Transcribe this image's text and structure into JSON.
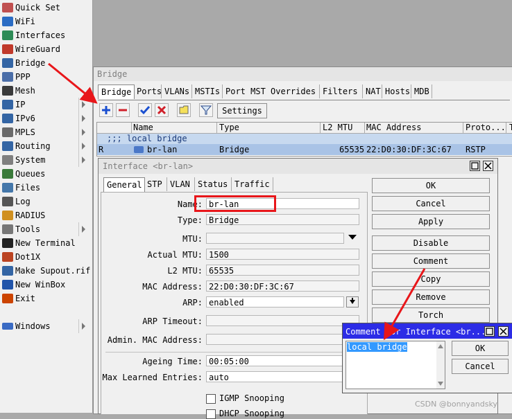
{
  "menu": {
    "items": [
      {
        "label": "Quick Set",
        "icon": "quick-set-icon",
        "arrow": false
      },
      {
        "label": "WiFi",
        "icon": "wifi-icon",
        "arrow": false
      },
      {
        "label": "Interfaces",
        "icon": "interfaces-icon",
        "arrow": false
      },
      {
        "label": "WireGuard",
        "icon": "wireguard-icon",
        "arrow": false
      },
      {
        "label": "Bridge",
        "icon": "bridge-icon",
        "arrow": false
      },
      {
        "label": "PPP",
        "icon": "ppp-icon",
        "arrow": false
      },
      {
        "label": "Mesh",
        "icon": "mesh-icon",
        "arrow": false
      },
      {
        "label": "IP",
        "icon": "ip-icon",
        "arrow": true
      },
      {
        "label": "IPv6",
        "icon": "ipv6-icon",
        "arrow": true
      },
      {
        "label": "MPLS",
        "icon": "mpls-icon",
        "arrow": true
      },
      {
        "label": "Routing",
        "icon": "routing-icon",
        "arrow": true
      },
      {
        "label": "System",
        "icon": "system-icon",
        "arrow": true
      },
      {
        "label": "Queues",
        "icon": "queues-icon",
        "arrow": false
      },
      {
        "label": "Files",
        "icon": "files-icon",
        "arrow": false
      },
      {
        "label": "Log",
        "icon": "log-icon",
        "arrow": false
      },
      {
        "label": "RADIUS",
        "icon": "radius-icon",
        "arrow": false
      },
      {
        "label": "Tools",
        "icon": "tools-icon",
        "arrow": true
      },
      {
        "label": "New Terminal",
        "icon": "terminal-icon",
        "arrow": false
      },
      {
        "label": "Dot1X",
        "icon": "dot1x-icon",
        "arrow": false
      },
      {
        "label": "Make Supout.rif",
        "icon": "supout-icon",
        "arrow": false
      },
      {
        "label": "New WinBox",
        "icon": "winbox-icon",
        "arrow": false
      },
      {
        "label": "Exit",
        "icon": "exit-icon",
        "arrow": false
      }
    ],
    "windows_label": "Windows"
  },
  "bridge_window": {
    "title": "Bridge",
    "tabs": [
      "Bridge",
      "Ports",
      "VLANs",
      "MSTIs",
      "Port MST Overrides",
      "Filters",
      "NAT",
      "Hosts",
      "MDB"
    ],
    "settings_label": "Settings",
    "columns": [
      "Name",
      "Type",
      "L2 MTU",
      "MAC Address",
      "Proto...",
      "T"
    ],
    "comment_row": ";;; local bridge",
    "row": {
      "flag": "R",
      "name": "br-lan",
      "type": "Bridge",
      "l2mtu": "65535",
      "mac": "22:D0:30:DF:3C:67",
      "proto": "RSTP"
    }
  },
  "interface_window": {
    "title": "Interface <br-lan>",
    "tabs": [
      "General",
      "STP",
      "VLAN",
      "Status",
      "Traffic"
    ],
    "fields": {
      "name_label": "Name:",
      "name": "br-lan",
      "type_label": "Type:",
      "type": "Bridge",
      "mtu_label": "MTU:",
      "mtu": "",
      "actual_mtu_label": "Actual MTU:",
      "actual_mtu": "1500",
      "l2mtu_label": "L2 MTU:",
      "l2mtu": "65535",
      "mac_label": "MAC Address:",
      "mac": "22:D0:30:DF:3C:67",
      "arp_label": "ARP:",
      "arp": "enabled",
      "arp_timeout_label": "ARP Timeout:",
      "arp_timeout": "",
      "admin_mac_label": "Admin. MAC Address:",
      "admin_mac": "",
      "ageing_label": "Ageing Time:",
      "ageing": "00:05:00",
      "max_learned_label": "Max Learned Entries:",
      "max_learned": "auto",
      "igmp_label": "IGMP Snooping",
      "dhcp_label": "DHCP Snooping"
    },
    "buttons": [
      "OK",
      "Cancel",
      "Apply",
      "Disable",
      "Comment",
      "Copy",
      "Remove",
      "Torch"
    ]
  },
  "comment_window": {
    "title": "Comment for Interface <br...",
    "text": "local bridge",
    "ok": "OK",
    "cancel": "Cancel"
  },
  "watermark": "CSDN @bonnyandsky",
  "colors": {
    "annotation": "#e8161a",
    "selection": "#3399ff",
    "comment_title": "#2c2ce6"
  }
}
